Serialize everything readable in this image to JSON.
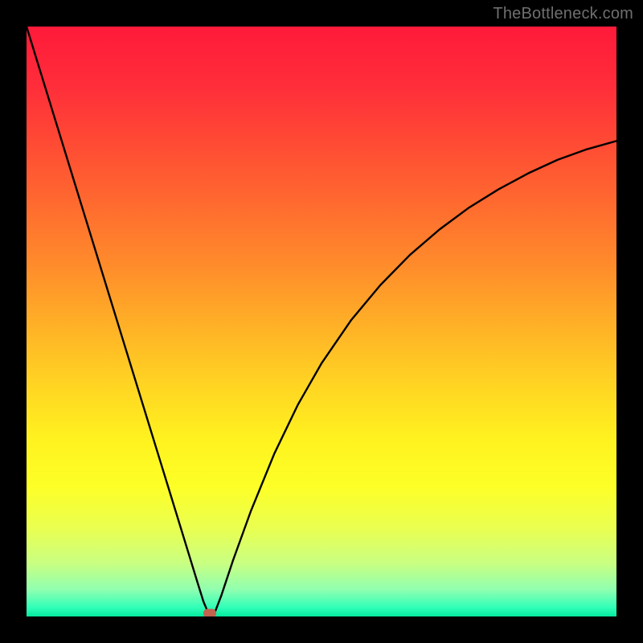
{
  "watermark": "TheBottleneck.com",
  "chart_data": {
    "type": "line",
    "title": "",
    "xlabel": "",
    "ylabel": "",
    "xlim": [
      0,
      100
    ],
    "ylim": [
      0,
      100
    ],
    "background_gradient": {
      "stops": [
        {
          "pos": 0.0,
          "color": "#ff1a3a"
        },
        {
          "pos": 0.1,
          "color": "#ff2d3a"
        },
        {
          "pos": 0.2,
          "color": "#ff4b34"
        },
        {
          "pos": 0.3,
          "color": "#ff6a2f"
        },
        {
          "pos": 0.4,
          "color": "#ff8a2b"
        },
        {
          "pos": 0.5,
          "color": "#ffae27"
        },
        {
          "pos": 0.6,
          "color": "#ffd223"
        },
        {
          "pos": 0.7,
          "color": "#fff21f"
        },
        {
          "pos": 0.78,
          "color": "#fdff27"
        },
        {
          "pos": 0.85,
          "color": "#eaff50"
        },
        {
          "pos": 0.91,
          "color": "#c9ff82"
        },
        {
          "pos": 0.955,
          "color": "#8fffb0"
        },
        {
          "pos": 0.985,
          "color": "#2fffb8"
        },
        {
          "pos": 1.0,
          "color": "#05e89e"
        }
      ]
    },
    "series": [
      {
        "name": "curve",
        "color": "#000000",
        "stroke_width": 2.4,
        "x": [
          0,
          2,
          4,
          6,
          8,
          10,
          12,
          14,
          16,
          18,
          20,
          22,
          24,
          26,
          27.5,
          29,
          30,
          30.8,
          31.4,
          32,
          33,
          35,
          38,
          42,
          46,
          50,
          55,
          60,
          65,
          70,
          75,
          80,
          85,
          90,
          95,
          100
        ],
        "y": [
          100,
          93.5,
          87,
          80.5,
          74,
          67.5,
          61,
          54.5,
          48,
          41.5,
          35,
          28.5,
          22,
          15.5,
          10.6,
          5.7,
          2.5,
          0.6,
          0.1,
          0.9,
          3.5,
          9.5,
          17.8,
          27.6,
          35.9,
          42.9,
          50.2,
          56.2,
          61.3,
          65.6,
          69.3,
          72.4,
          75.1,
          77.4,
          79.2,
          80.6
        ]
      }
    ],
    "marker": {
      "x": 31.1,
      "y": 0.5,
      "color": "#C1634F"
    },
    "grid": false,
    "legend": false
  }
}
